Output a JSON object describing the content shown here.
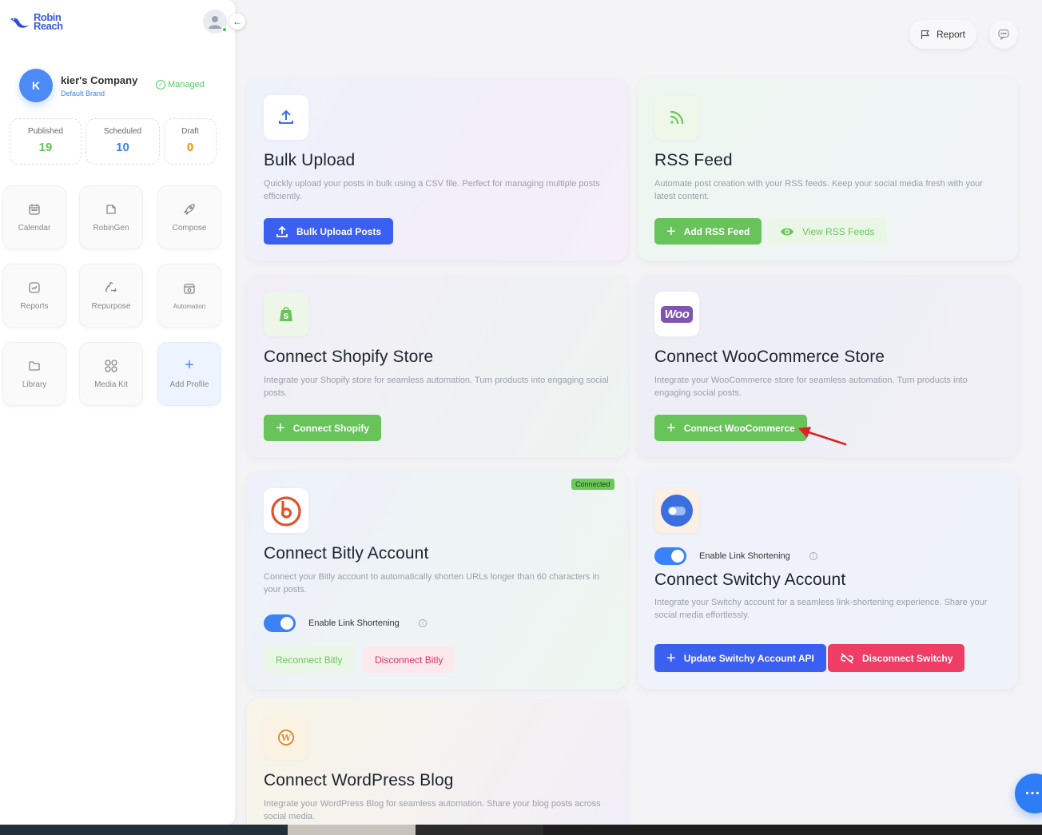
{
  "sidebar": {
    "logo_line1": "Robin",
    "logo_line2": "Reach",
    "collapse_icon": "←",
    "company": {
      "initial": "K",
      "name": "kier's Company",
      "brand": "Default Brand",
      "status": "Managed"
    },
    "stats": [
      {
        "label": "Published",
        "value": "19",
        "color": "#67c35a"
      },
      {
        "label": "Scheduled",
        "value": "10",
        "color": "#3b82f6"
      },
      {
        "label": "Draft",
        "value": "0",
        "color": "#f08c00"
      }
    ],
    "tiles": [
      {
        "label": "Calendar",
        "icon": "calendar-icon"
      },
      {
        "label": "RobinGen",
        "icon": "robingen-icon"
      },
      {
        "label": "Compose",
        "icon": "rocket-icon"
      },
      {
        "label": "Reports",
        "icon": "chart-icon"
      },
      {
        "label": "Repurpose",
        "icon": "recycle-icon"
      },
      {
        "label": "Automation",
        "icon": "automation-icon"
      },
      {
        "label": "Library",
        "icon": "folder-icon"
      },
      {
        "label": "Media Kit",
        "icon": "grid-icon"
      },
      {
        "label": "Add Profile",
        "icon": "plus-icon"
      }
    ]
  },
  "header": {
    "report_label": "Report"
  },
  "cards": {
    "bulk": {
      "title": "Bulk Upload",
      "desc": "Quickly upload your posts in bulk using a CSV file. Perfect for managing multiple posts efficiently.",
      "btn": "Bulk Upload Posts"
    },
    "rss": {
      "title": "RSS Feed",
      "desc": "Automate post creation with your RSS feeds. Keep your social media fresh with your latest content.",
      "btn_add": "Add RSS Feed",
      "btn_view": "View RSS Feeds"
    },
    "shopify": {
      "title": "Connect Shopify Store",
      "desc": "Integrate your Shopify store for seamless automation. Turn products into engaging social posts.",
      "btn": "Connect Shopify"
    },
    "woo": {
      "logo": "Woo",
      "title": "Connect WooCommerce Store",
      "desc": "Integrate your WooCommerce store for seamless automation. Turn products into engaging social posts.",
      "btn": "Connect WooCommerce"
    },
    "bitly": {
      "badge": "Connected",
      "title": "Connect Bitly Account",
      "desc": "Connect your Bitly account to automatically shorten URLs longer than 60 characters in your posts.",
      "toggle_label": "Enable Link Shortening",
      "btn_reconnect": "Reconnect Bitly",
      "btn_disconnect": "Disconnect Bitly"
    },
    "switchy": {
      "toggle_label": "Enable Link Shortening",
      "title": "Connect Switchy Account",
      "desc": "Integrate your Switchy account for a seamless link-shortening experience. Share your social media effortlessly.",
      "btn_update": "Update Switchy Account API",
      "btn_disconnect": "Disconnect Switchy"
    },
    "wordpress": {
      "title": "Connect WordPress Blog",
      "desc": "Integrate your WordPress Blog for seamless automation. Share your blog posts across social media."
    }
  }
}
